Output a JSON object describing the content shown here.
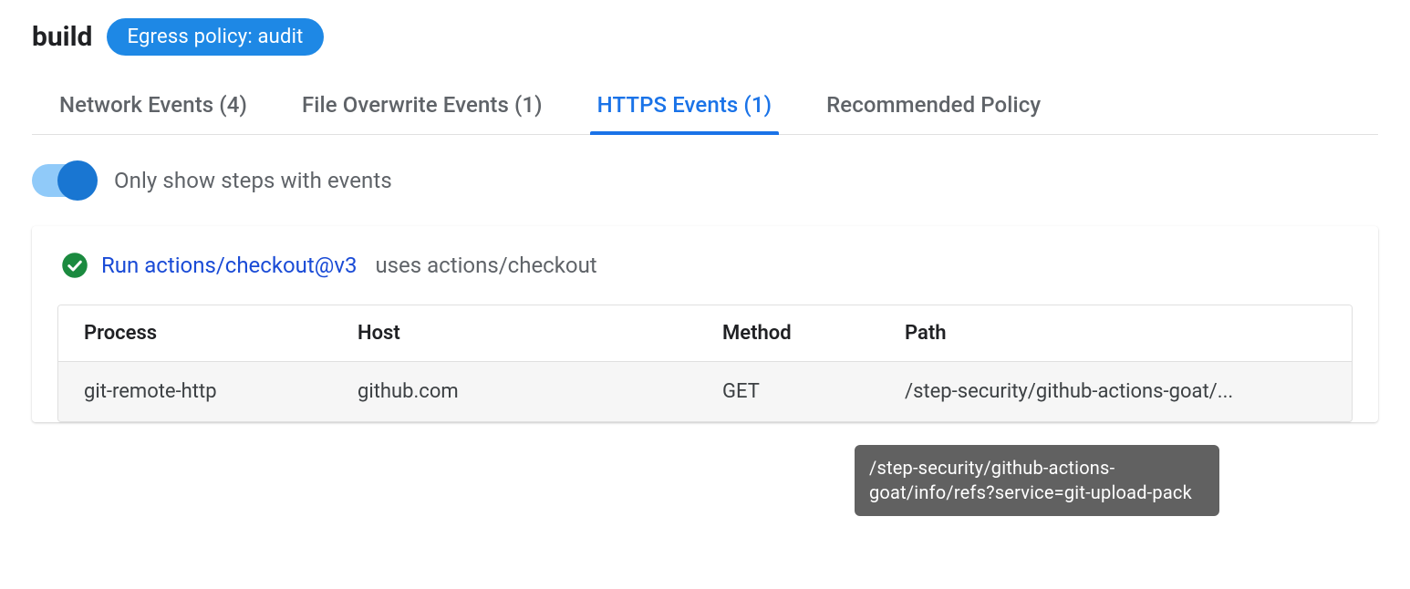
{
  "header": {
    "title": "build",
    "badge": "Egress policy: audit"
  },
  "tabs": [
    {
      "label": "Network Events (4)",
      "active": false
    },
    {
      "label": "File Overwrite Events (1)",
      "active": false
    },
    {
      "label": "HTTPS Events (1)",
      "active": true
    },
    {
      "label": "Recommended Policy",
      "active": false
    }
  ],
  "filter": {
    "toggle_label": "Only show steps with events",
    "toggle_on": true
  },
  "step": {
    "link_text": "Run actions/checkout@v3",
    "uses_text": "uses actions/checkout"
  },
  "table": {
    "headers": {
      "process": "Process",
      "host": "Host",
      "method": "Method",
      "path": "Path"
    },
    "rows": [
      {
        "process": "git-remote-http",
        "host": "github.com",
        "method": "GET",
        "path": "/step-security/github-actions-goat/..."
      }
    ]
  },
  "tooltip": "/step-security/github-actions-goat/info/refs?service=git-upload-pack"
}
